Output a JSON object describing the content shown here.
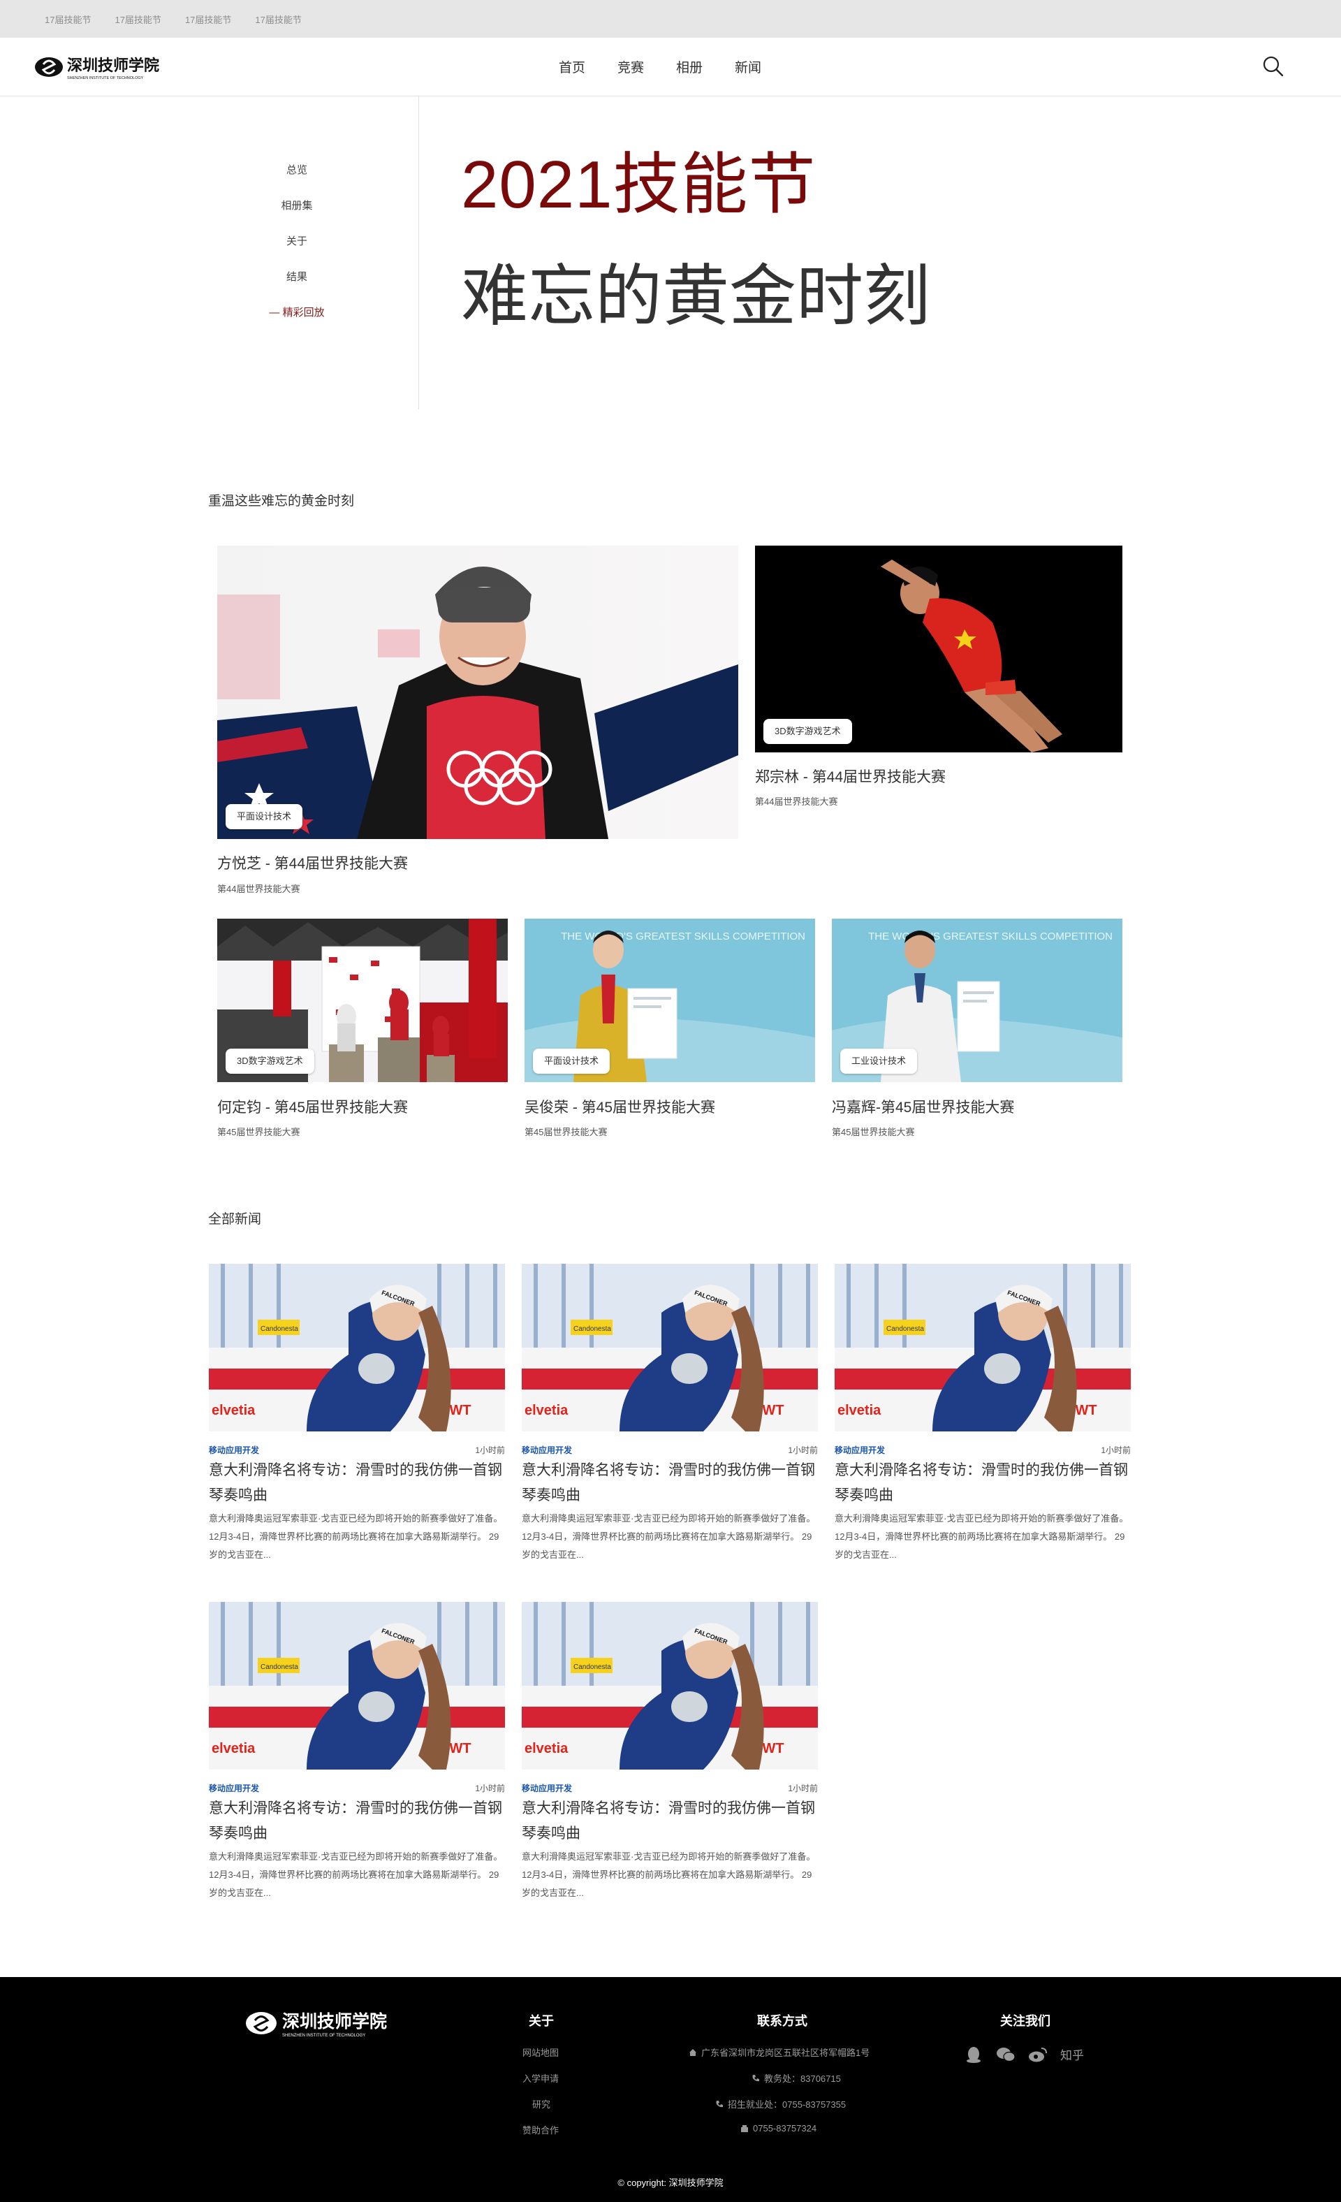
{
  "topbar": {
    "links": [
      "17届技能节",
      "17届技能节",
      "17届技能节",
      "17届技能节"
    ]
  },
  "header": {
    "nav": [
      "首页",
      "竞赛",
      "相册",
      "新闻"
    ],
    "logo_text": "深圳技师学院",
    "logo_sub": "SHENZHEN INSTITUTE OF TECHNOLOGY"
  },
  "sidebar": {
    "items": [
      "总览",
      "相册集",
      "关于",
      "结果",
      "— 精彩回放"
    ]
  },
  "hero": {
    "title": "2021技能节",
    "subtitle": "难忘的黄金时刻"
  },
  "featured": {
    "heading": "重温这些难忘的黄金时刻",
    "cards": [
      {
        "tag": "平面设计技术",
        "title": "方悦芝 - 第44届世界技能大赛",
        "sub": "第44届世界技能大赛"
      },
      {
        "tag": "3D数字游戏艺术",
        "title": "郑宗林 - 第44届世界技能大赛",
        "sub": "第44届世界技能大赛"
      },
      {
        "tag": "3D数字游戏艺术",
        "title": "何定钧 - 第45届世界技能大赛",
        "sub": "第45届世界技能大赛"
      },
      {
        "tag": "平面设计技术",
        "title": "吴俊荣 - 第45届世界技能大赛",
        "sub": "第45届世界技能大赛"
      },
      {
        "tag": "工业设计技术",
        "title": "冯嘉辉-第45届世界技能大赛",
        "sub": "第45届世界技能大赛"
      }
    ],
    "banner_text": "THE WORLD'S GREATEST SKILLS COMPETITION"
  },
  "news": {
    "heading": "全部新闻",
    "items": [
      {
        "category": "移动应用开发",
        "time": "1小时前",
        "title": "意大利滑降名将专访：滑雪时的我仿佛一首钢琴奏鸣曲",
        "excerpt": "意大利滑降奥运冠军索菲亚·戈吉亚已经为即将开始的新赛季做好了准备。12月3-4日，滑降世界杯比赛的前两场比赛将在加拿大路易斯湖举行。 29岁的戈吉亚在..."
      },
      {
        "category": "移动应用开发",
        "time": "1小时前",
        "title": "意大利滑降名将专访：滑雪时的我仿佛一首钢琴奏鸣曲",
        "excerpt": "意大利滑降奥运冠军索菲亚·戈吉亚已经为即将开始的新赛季做好了准备。12月3-4日，滑降世界杯比赛的前两场比赛将在加拿大路易斯湖举行。 29岁的戈吉亚在..."
      },
      {
        "category": "移动应用开发",
        "time": "1小时前",
        "title": "意大利滑降名将专访：滑雪时的我仿佛一首钢琴奏鸣曲",
        "excerpt": "意大利滑降奥运冠军索菲亚·戈吉亚已经为即将开始的新赛季做好了准备。12月3-4日，滑降世界杯比赛的前两场比赛将在加拿大路易斯湖举行。 29岁的戈吉亚在..."
      },
      {
        "category": "移动应用开发",
        "time": "1小时前",
        "title": "意大利滑降名将专访：滑雪时的我仿佛一首钢琴奏鸣曲",
        "excerpt": "意大利滑降奥运冠军索菲亚·戈吉亚已经为即将开始的新赛季做好了准备。12月3-4日，滑降世界杯比赛的前两场比赛将在加拿大路易斯湖举行。 29岁的戈吉亚在..."
      },
      {
        "category": "移动应用开发",
        "time": "1小时前",
        "title": "意大利滑降名将专访：滑雪时的我仿佛一首钢琴奏鸣曲",
        "excerpt": "意大利滑降奥运冠军索菲亚·戈吉亚已经为即将开始的新赛季做好了准备。12月3-4日，滑降世界杯比赛的前两场比赛将在加拿大路易斯湖举行。 29岁的戈吉亚在..."
      }
    ],
    "image_text": {
      "brand": "FALCONER",
      "sponsor1": "Candonesta",
      "sponsor2": "elvetia",
      "sponsor3": "BWT"
    }
  },
  "footer": {
    "logo_text": "深圳技师学院",
    "logo_sub": "SHENZHEN INSTITUTE OF TECHNOLOGY",
    "about_title": "关于",
    "about_items": [
      "网站地图",
      "入学申请",
      "研究",
      "赞助合作"
    ],
    "contact_title": "联系方式",
    "contact_items": [
      "广东省深圳市龙岗区五联社区将军帽路1号",
      "教务处：83706715",
      "招生就业处：0755-83757355",
      "0755-83757324"
    ],
    "follow_title": "关注我们",
    "zhihu": "知乎",
    "copyright": "© copyright: 深圳技师学院"
  },
  "colors": {
    "accent": "#7a0a0a",
    "news_category": "#1a56b0",
    "footer_bg": "#000000"
  }
}
